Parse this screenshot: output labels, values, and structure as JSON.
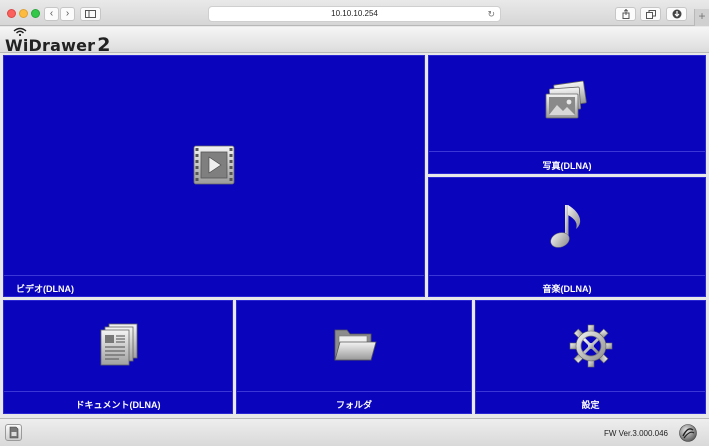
{
  "browser": {
    "url": "10.10.10.254",
    "icons": [
      "back-icon",
      "forward-icon",
      "sidebar-icon",
      "reload-icon",
      "share-icon",
      "tabs-icon",
      "download-icon",
      "new-tab-icon"
    ]
  },
  "app": {
    "logo_text": "WiDrawer",
    "logo_number": "2"
  },
  "tiles": {
    "video": {
      "label": "ビデオ(DLNA)",
      "icon": "video-icon"
    },
    "photo": {
      "label": "写真(DLNA)",
      "icon": "photo-icon"
    },
    "music": {
      "label": "音楽(DLNA)",
      "icon": "music-note-icon"
    },
    "docs": {
      "label": "ドキュメント(DLNA)",
      "icon": "documents-icon"
    },
    "folder": {
      "label": "フォルダ",
      "icon": "folder-icon"
    },
    "settings": {
      "label": "設定",
      "icon": "gear-icon"
    }
  },
  "colors": {
    "tile_bg": "#0a05bd",
    "tile_border": "#2a26d2",
    "label": "#ffffff"
  },
  "footer": {
    "fw_version": "FW Ver.3.000.046"
  }
}
